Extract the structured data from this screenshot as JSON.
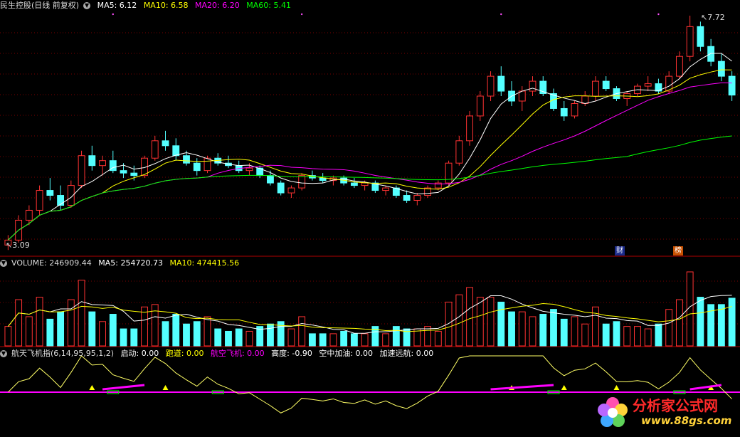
{
  "panels": {
    "price": {
      "title": "民生控股(日线 前复权)",
      "indicators": [
        {
          "label": "MA5: 6.12",
          "color": "#ffffff"
        },
        {
          "label": "MA10: 6.58",
          "color": "#ffff00"
        },
        {
          "label": "MA20: 6.20",
          "color": "#ff00ff"
        },
        {
          "label": "MA60: 5.41",
          "color": "#00ff00"
        }
      ],
      "high_label": "7.72",
      "low_label": "3.09",
      "badge_finance": "财",
      "badge_rank": "榜"
    },
    "volume": {
      "title": "VOLUME: 246909.44",
      "indicators": [
        {
          "label": "MA5: 254720.73",
          "color": "#ffffff"
        },
        {
          "label": "MA10: 474415.56",
          "color": "#ffff00"
        }
      ]
    },
    "indicator": {
      "title": "航天飞机指(6,14,95,95,1,2)",
      "indicators": [
        {
          "label": "启动: 0.00",
          "color": "#ffffff"
        },
        {
          "label": "跑道: 0.00",
          "color": "#ffff00"
        },
        {
          "label": "航空飞机: 0.00",
          "color": "#ff00ff"
        },
        {
          "label": "高度: -0.90",
          "color": "#ffffff"
        },
        {
          "label": "空中加油: 0.00",
          "color": "#ffffff"
        },
        {
          "label": "加速远航: 0.00",
          "color": "#ffffff"
        }
      ]
    }
  },
  "watermark": {
    "text": "分析家公式网",
    "url": "www.88gs.com"
  },
  "colors": {
    "up": "#ff3232",
    "down": "#54ffff",
    "ma5": "#ffffff",
    "ma10": "#ffff00",
    "ma20": "#ff00ff",
    "ma60": "#00ff00",
    "grid": "#7a0000",
    "separator": "#b00000"
  },
  "chart_data": {
    "type": "candlestick",
    "price_high": 7.72,
    "price_low": 3.09,
    "ohlc": [
      [
        3.1,
        3.3,
        3.0,
        3.2
      ],
      [
        3.2,
        3.7,
        3.15,
        3.6
      ],
      [
        3.6,
        3.9,
        3.5,
        3.8
      ],
      [
        3.8,
        4.3,
        3.7,
        4.2
      ],
      [
        4.2,
        4.45,
        4.0,
        4.1
      ],
      [
        4.1,
        4.3,
        3.8,
        3.9
      ],
      [
        3.9,
        4.4,
        3.85,
        4.3
      ],
      [
        4.3,
        5.0,
        4.25,
        4.9
      ],
      [
        4.9,
        5.1,
        4.6,
        4.7
      ],
      [
        4.7,
        4.9,
        4.5,
        4.8
      ],
      [
        4.8,
        5.0,
        4.55,
        4.6
      ],
      [
        4.6,
        4.75,
        4.45,
        4.55
      ],
      [
        4.55,
        4.7,
        4.4,
        4.5
      ],
      [
        4.5,
        4.9,
        4.45,
        4.85
      ],
      [
        4.85,
        5.3,
        4.8,
        5.2
      ],
      [
        5.2,
        5.4,
        5.0,
        5.1
      ],
      [
        5.1,
        5.25,
        4.8,
        4.9
      ],
      [
        4.9,
        5.0,
        4.7,
        4.75
      ],
      [
        4.75,
        4.85,
        4.5,
        4.6
      ],
      [
        4.6,
        4.9,
        4.55,
        4.85
      ],
      [
        4.85,
        4.95,
        4.7,
        4.75
      ],
      [
        4.75,
        4.9,
        4.65,
        4.7
      ],
      [
        4.7,
        4.8,
        4.55,
        4.6
      ],
      [
        4.6,
        4.75,
        4.5,
        4.65
      ],
      [
        4.65,
        4.7,
        4.45,
        4.5
      ],
      [
        4.5,
        4.6,
        4.3,
        4.35
      ],
      [
        4.35,
        4.4,
        4.1,
        4.15
      ],
      [
        4.15,
        4.3,
        4.05,
        4.25
      ],
      [
        4.25,
        4.55,
        4.2,
        4.5
      ],
      [
        4.5,
        4.6,
        4.4,
        4.45
      ],
      [
        4.45,
        4.55,
        4.35,
        4.4
      ],
      [
        4.4,
        4.5,
        4.3,
        4.45
      ],
      [
        4.45,
        4.5,
        4.3,
        4.35
      ],
      [
        4.35,
        4.45,
        4.25,
        4.3
      ],
      [
        4.3,
        4.4,
        4.2,
        4.35
      ],
      [
        4.35,
        4.4,
        4.15,
        4.2
      ],
      [
        4.2,
        4.3,
        4.1,
        4.25
      ],
      [
        4.25,
        4.3,
        4.05,
        4.1
      ],
      [
        4.1,
        4.2,
        3.95,
        4.0
      ],
      [
        4.0,
        4.15,
        3.9,
        4.1
      ],
      [
        4.1,
        4.3,
        4.05,
        4.25
      ],
      [
        4.25,
        4.4,
        4.2,
        4.35
      ],
      [
        4.35,
        4.8,
        4.3,
        4.75
      ],
      [
        4.75,
        5.3,
        4.7,
        5.2
      ],
      [
        5.2,
        5.8,
        5.1,
        5.7
      ],
      [
        5.7,
        6.2,
        5.6,
        6.1
      ],
      [
        6.1,
        6.6,
        6.0,
        6.5
      ],
      [
        6.5,
        6.7,
        6.1,
        6.2
      ],
      [
        6.2,
        6.4,
        5.9,
        6.0
      ],
      [
        6.0,
        6.3,
        5.8,
        6.2
      ],
      [
        6.2,
        6.5,
        6.1,
        6.4
      ],
      [
        6.4,
        6.5,
        6.1,
        6.15
      ],
      [
        6.15,
        6.25,
        5.8,
        5.85
      ],
      [
        5.85,
        6.0,
        5.6,
        5.7
      ],
      [
        5.7,
        6.0,
        5.65,
        5.95
      ],
      [
        5.95,
        6.2,
        5.9,
        6.1
      ],
      [
        6.1,
        6.5,
        6.0,
        6.4
      ],
      [
        6.4,
        6.5,
        6.2,
        6.25
      ],
      [
        6.25,
        6.3,
        6.0,
        6.05
      ],
      [
        6.05,
        6.2,
        5.9,
        6.15
      ],
      [
        6.15,
        6.35,
        6.1,
        6.3
      ],
      [
        6.3,
        6.5,
        6.2,
        6.35
      ],
      [
        6.35,
        6.45,
        6.15,
        6.2
      ],
      [
        6.2,
        6.6,
        6.15,
        6.5
      ],
      [
        6.5,
        7.0,
        6.45,
        6.9
      ],
      [
        6.9,
        7.72,
        6.8,
        7.5
      ],
      [
        7.5,
        7.6,
        7.0,
        7.1
      ],
      [
        7.1,
        7.25,
        6.7,
        6.8
      ],
      [
        6.8,
        6.95,
        6.4,
        6.5
      ],
      [
        6.5,
        6.6,
        6.0,
        6.12
      ]
    ],
    "volume_ma5": 254720.73,
    "volume_ma10": 474415.56,
    "volume_last": 246909.44
  }
}
